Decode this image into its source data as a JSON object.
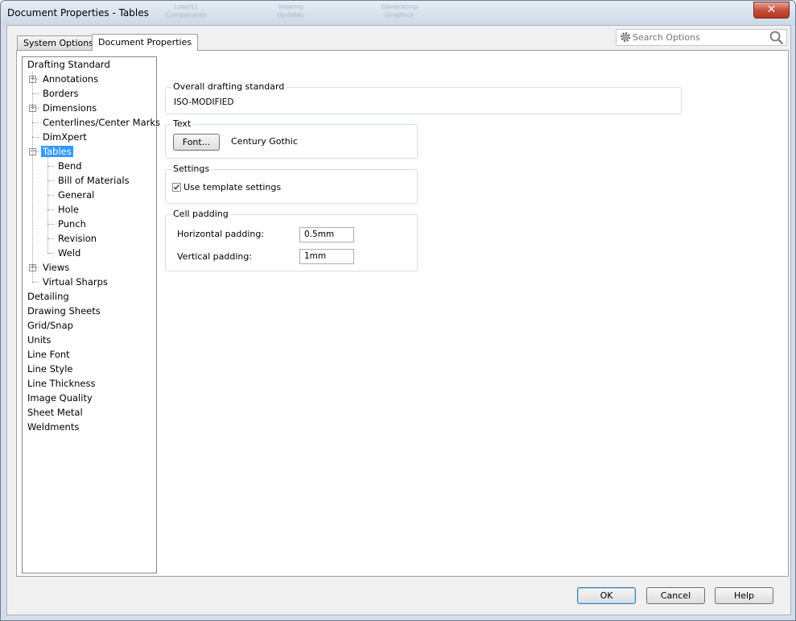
{
  "window": {
    "title": "Document Properties - Tables",
    "background_toolbar_labels": [
      "Load/Lt Components",
      "Viewing Updates",
      "Generating Graphics"
    ]
  },
  "tabs": [
    {
      "label": "System Options",
      "active": false
    },
    {
      "label": "Document Properties",
      "active": true
    }
  ],
  "search": {
    "placeholder": "Search Options"
  },
  "tree": {
    "items": [
      {
        "label": "Drafting Standard",
        "level": 0,
        "selected": false
      },
      {
        "label": "Annotations",
        "level": 1,
        "expandable": true,
        "expanded": false
      },
      {
        "label": "Borders",
        "level": 1
      },
      {
        "label": "Dimensions",
        "level": 1,
        "expandable": true,
        "expanded": false
      },
      {
        "label": "Centerlines/Center Marks",
        "level": 1
      },
      {
        "label": "DimXpert",
        "level": 1
      },
      {
        "label": "Tables",
        "level": 1,
        "expandable": true,
        "expanded": true,
        "selected": true
      },
      {
        "label": "Bend",
        "level": 2
      },
      {
        "label": "Bill of Materials",
        "level": 2
      },
      {
        "label": "General",
        "level": 2
      },
      {
        "label": "Hole",
        "level": 2
      },
      {
        "label": "Punch",
        "level": 2
      },
      {
        "label": "Revision",
        "level": 2
      },
      {
        "label": "Weld",
        "level": 2
      },
      {
        "label": "Views",
        "level": 1,
        "expandable": true,
        "expanded": false
      },
      {
        "label": "Virtual Sharps",
        "level": 1
      },
      {
        "label": "Detailing",
        "level": 0
      },
      {
        "label": "Drawing Sheets",
        "level": 0
      },
      {
        "label": "Grid/Snap",
        "level": 0
      },
      {
        "label": "Units",
        "level": 0
      },
      {
        "label": "Line Font",
        "level": 0
      },
      {
        "label": "Line Style",
        "level": 0
      },
      {
        "label": "Line Thickness",
        "level": 0
      },
      {
        "label": "Image Quality",
        "level": 0
      },
      {
        "label": "Sheet Metal",
        "level": 0
      },
      {
        "label": "Weldments",
        "level": 0
      }
    ]
  },
  "overall_standard": {
    "title": "Overall drafting standard",
    "value": "ISO-MODIFIED"
  },
  "text_group": {
    "title": "Text",
    "font_button": "Font...",
    "font_name": "Century Gothic"
  },
  "settings_group": {
    "title": "Settings",
    "use_template_label": "Use template settings",
    "use_template_checked": true
  },
  "cell_padding": {
    "title": "Cell padding",
    "horizontal_label": "Horizontal padding:",
    "horizontal_value": "0.5mm",
    "vertical_label": "Vertical padding:",
    "vertical_value": "1mm"
  },
  "buttons": {
    "ok": "OK",
    "cancel": "Cancel",
    "help": "Help"
  },
  "colors": {
    "selection": "#3399ff",
    "close_button": "#c7503e"
  }
}
